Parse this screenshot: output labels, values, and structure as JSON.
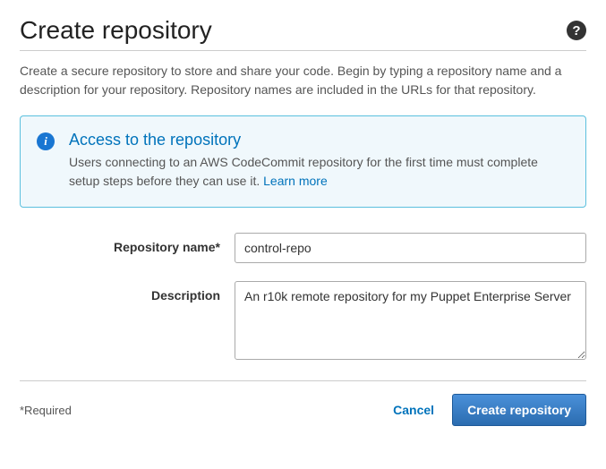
{
  "header": {
    "title": "Create repository"
  },
  "intro": "Create a secure repository to store and share your code. Begin by typing a repository name and a description for your repository. Repository names are included in the URLs for that repository.",
  "infoBox": {
    "title": "Access to the repository",
    "body": "Users connecting to an AWS CodeCommit repository for the first time must complete setup steps before they can use it. ",
    "learnMore": "Learn more"
  },
  "form": {
    "repoNameLabel": "Repository name*",
    "repoNameValue": "control-repo",
    "descriptionLabel": "Description",
    "descriptionValue": "An r10k remote repository for my Puppet Enterprise Server"
  },
  "footer": {
    "requiredNote": "*Required",
    "cancel": "Cancel",
    "submit": "Create repository"
  }
}
